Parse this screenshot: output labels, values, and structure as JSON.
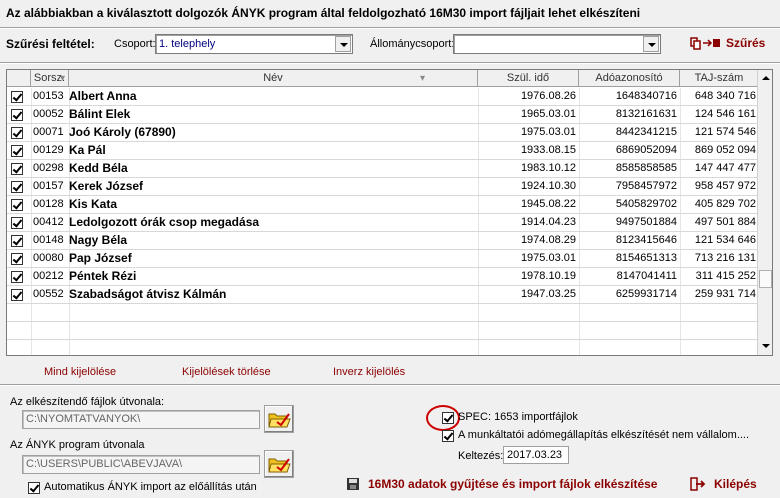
{
  "header": {
    "title": "Az alábbiakban a kiválasztott dolgozók ÁNYK program által feldolgozható 16M30 import fájljait lehet elkészíteni"
  },
  "filter": {
    "label": "Szűrési feltétel:",
    "group_label": "Csoport:",
    "group_value": "1. telephely",
    "staff_label": "Állománycsoport:",
    "staff_value": "",
    "filter_button": "Szűrés"
  },
  "grid": {
    "columns": [
      "Sorsz.",
      "Név",
      "Szül. idő",
      "Adóazonosító",
      "TAJ-szám"
    ],
    "rows": [
      {
        "num": "00153",
        "name": "Albert Anna",
        "birth": "1976.08.26",
        "tax": "1648340716",
        "taj": "648 340 716"
      },
      {
        "num": "00052",
        "name": "Bálint Elek",
        "birth": "1965.03.01",
        "tax": "8132161631",
        "taj": "124 546 161"
      },
      {
        "num": "00071",
        "name": "Joó Károly  (67890)",
        "birth": "1975.03.01",
        "tax": "8442341215",
        "taj": "121 574 546"
      },
      {
        "num": "00129",
        "name": "Ka Pál",
        "birth": "1933.08.15",
        "tax": "6869052094",
        "taj": "869 052 094"
      },
      {
        "num": "00298",
        "name": "Kedd Béla",
        "birth": "1983.10.12",
        "tax": "8585858585",
        "taj": "147 447 477"
      },
      {
        "num": "00157",
        "name": "Kerek József",
        "birth": "1924.10.30",
        "tax": "7958457972",
        "taj": "958 457 972"
      },
      {
        "num": "00128",
        "name": "Kis Kata",
        "birth": "1945.08.22",
        "tax": "5405829702",
        "taj": "405 829 702"
      },
      {
        "num": "00412",
        "name": "Ledolgozott órák csop megadása",
        "birth": "1914.04.23",
        "tax": "9497501884",
        "taj": "497 501 884"
      },
      {
        "num": "00148",
        "name": "Nagy Béla",
        "birth": "1974.08.29",
        "tax": "8123415646",
        "taj": "121 534 646"
      },
      {
        "num": "00080",
        "name": "Pap József",
        "birth": "1975.03.01",
        "tax": "8154651313",
        "taj": "713 216 131"
      },
      {
        "num": "00212",
        "name": "Péntek Rézi",
        "birth": "1978.10.19",
        "tax": "8147041411",
        "taj": "311 415 252"
      },
      {
        "num": "00552",
        "name": "Szabadságot átvisz Kálmán",
        "birth": "1947.03.25",
        "tax": "6259931714",
        "taj": "259 931 714"
      }
    ]
  },
  "selection": {
    "select_all": "Mind kijelölése",
    "clear": "Kijelölések törlése",
    "invert": "Inverz kijelölés"
  },
  "paths": {
    "output_label": "Az elkészítendő fájlok útvonala:",
    "output_value": "C:\\NYOMTATVANYOK\\",
    "anyk_label": "Az ÁNYK program útvonala",
    "anyk_value": "C:\\USERS\\PUBLIC\\ABEVJAVA\\",
    "auto_import_label": "Automatikus ÁNYK import az előállítás után"
  },
  "options": {
    "spec_label": "SPEC: 1653 importfájlok",
    "employer_label": "A munkáltatói adómegállapítás elkészítését nem vállalom....",
    "date_label": "Keltezés:",
    "date_value": "2017.03.23"
  },
  "actions": {
    "generate": "16M30 adatok gyűjtése és import fájlok elkészítése",
    "exit": "Kilépés"
  },
  "colors": {
    "accent": "#8b0000",
    "value_blue": "#000080",
    "highlight_circle": "#cc0000"
  }
}
